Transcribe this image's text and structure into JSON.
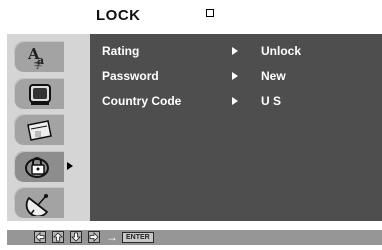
{
  "header": {
    "title": "LOCK"
  },
  "menu": {
    "rows": [
      {
        "label": "Rating",
        "value": "Unlock"
      },
      {
        "label": "Password",
        "value": "New"
      },
      {
        "label": "Country Code",
        "value": "U S"
      }
    ]
  },
  "sidebar": {
    "tabs": [
      {
        "icon": "language-icon",
        "active": false
      },
      {
        "icon": "tv-icon",
        "active": false
      },
      {
        "icon": "calendar-icon",
        "active": false
      },
      {
        "icon": "lock-icon",
        "active": true
      },
      {
        "icon": "satellite-dish-icon",
        "active": false
      }
    ]
  },
  "footer": {
    "nav_keys": [
      "left-key-icon",
      "up-key-icon",
      "down-key-icon",
      "right-key-icon"
    ],
    "arrow_glyph": "→",
    "enter_label": "ENTER"
  }
}
